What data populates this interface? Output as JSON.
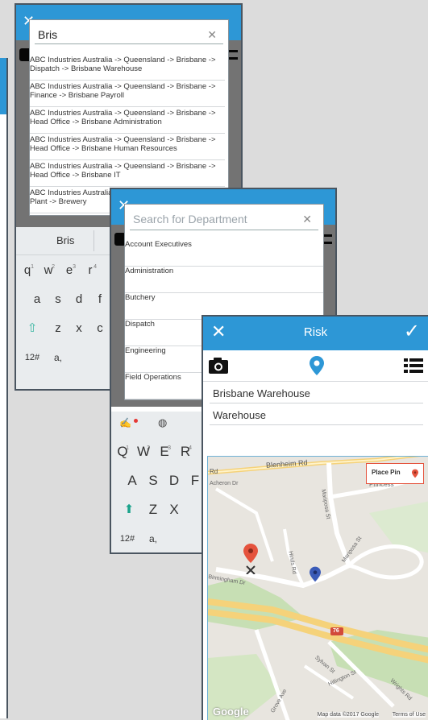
{
  "screen1": {
    "search_value": "Bris",
    "clear_icon": "✕",
    "results": [
      "ABC Industries Australia -> Queensland -> Brisbane -> Dispatch -> Brisbane Warehouse",
      "ABC Industries Australia -> Queensland -> Brisbane -> Finance -> Brisbane Payroll",
      "ABC Industries Australia -> Queensland -> Brisbane -> Head Office -> Brisbane Administration",
      "ABC Industries Australia -> Queensland -> Brisbane -> Head Office -> Brisbane Human Resources",
      "ABC Industries Australia -> Queensland -> Brisbane -> Head Office -> Brisbane IT",
      "ABC Industries Australia -> Queensland -> Brisbane -> Plant -> Brewery"
    ],
    "suggestion": "Bris",
    "keys_row1": [
      "q",
      "w",
      "e",
      "r"
    ],
    "keys_row1_nums": [
      "1",
      "2",
      "3",
      "4"
    ],
    "keys_row2": [
      "a",
      "s",
      "d",
      "f"
    ],
    "keys_row3": [
      "z",
      "x",
      "c"
    ],
    "key_symbols": "12#",
    "key_punct": "a,"
  },
  "screen2": {
    "search_placeholder": "Search for Department",
    "clear_icon": "✕",
    "departments": [
      "Account Executives",
      "Administration",
      "Butchery",
      "Dispatch",
      "Engineering",
      "Field Operations"
    ],
    "keys_row1": [
      "Q",
      "W",
      "E",
      "R"
    ],
    "keys_row1_nums": [
      "1",
      "2",
      "3",
      "4"
    ],
    "keys_row2": [
      "A",
      "S",
      "D",
      "F"
    ],
    "keys_row3": [
      "Z",
      "X"
    ],
    "key_symbols": "12#",
    "key_punct": "a,"
  },
  "screen3": {
    "title": "Risk",
    "close_icon": "✕",
    "confirm_icon": "✓",
    "location_name": "Brisbane Warehouse",
    "location_type": "Warehouse",
    "place_pin_label": "Place Pin",
    "map_labels": {
      "blenheim": "Blenheim Rd",
      "acheron": "Acheron Dr",
      "princess": "Princess",
      "mariposa1": "Mariposa St",
      "mariposa2": "Mariposa St",
      "birmingham": "Birmingham Dr",
      "hinds": "Hinds Rd",
      "sylvan": "Sylvan St",
      "hillington": "Hillington St",
      "wrights": "Wrights Rd",
      "grove": "Grove Ave",
      "route": "76",
      "rd": "Rd"
    },
    "google_logo": "Google",
    "attribution": "Map data ©2017 Google",
    "terms": "Terms of Use"
  }
}
